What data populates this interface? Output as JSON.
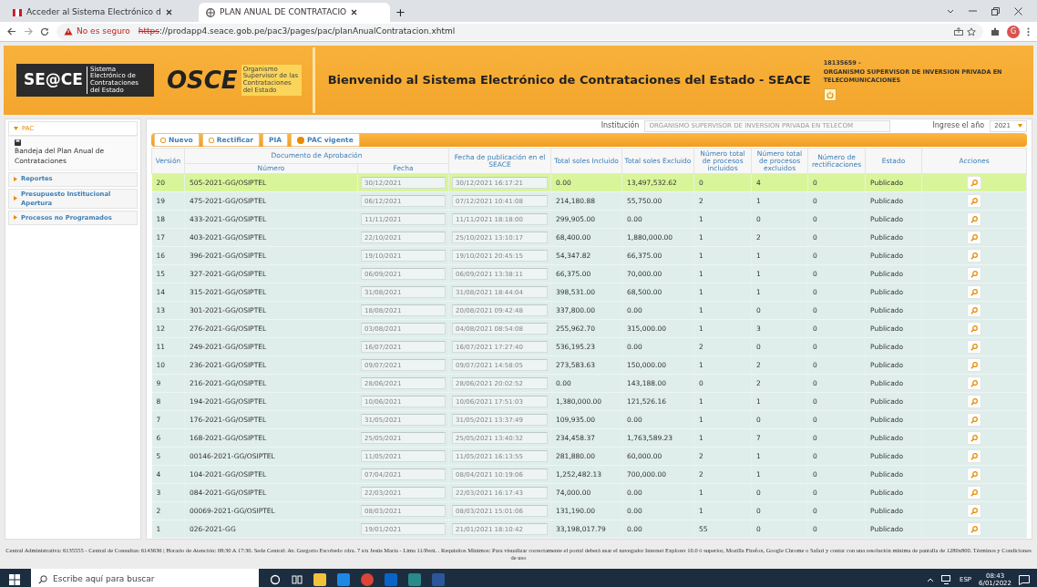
{
  "browser": {
    "tabs": [
      {
        "title": "Acceder al Sistema Electrónico d",
        "selected": false
      },
      {
        "title": "PLAN ANUAL DE CONTRATACIO",
        "selected": true
      }
    ],
    "new_tab": "+",
    "security": "No es seguro",
    "url_scheme": "https",
    "url_rest": "://prodapp4.seace.gob.pe/pac3/pages/pac/planAnualContratacion.xhtml",
    "profile": "G"
  },
  "header": {
    "seace_logo": "SE@CE",
    "seace_sub": "Sistema Electrónico de Contrataciones del Estado",
    "osce_logo": "OSCE",
    "osce_sub": "Organismo Supervisor de las Contrataciones del Estado",
    "title": "Bienvenido al Sistema Electrónico de Contrataciones del Estado - SEACE",
    "user_id": "18135659 -",
    "user_org": "ORGANISMO SUPERVISOR DE INVERSION PRIVADA EN TELECOMUNICACIONES"
  },
  "sidebar": {
    "items": [
      {
        "label": "PAC",
        "expanded": true,
        "children": [
          {
            "label": "Bandeja del Plan Anual de Contrataciones"
          }
        ]
      },
      {
        "label": "Reportes",
        "expanded": false
      },
      {
        "label": "Presupuesto Institucional Apertura",
        "expanded": false
      },
      {
        "label": "Procesos no Programados",
        "expanded": false
      }
    ]
  },
  "filters": {
    "institution_label": "Institución",
    "institution_value": "ORGANISMO SUPERVISOR DE INVERSION PRIVADA EN TELECOM",
    "year_label": "Ingrese el año",
    "year_value": "2021"
  },
  "toolbar": [
    {
      "label": "Nuevo",
      "kind": "dot"
    },
    {
      "label": "Rectificar",
      "kind": "dot"
    },
    {
      "label": "PIA",
      "kind": "plain"
    },
    {
      "label": "PAC vigente",
      "kind": "circle"
    }
  ],
  "table": {
    "group_label": "Documento de Aprobación",
    "columns": [
      "Versión",
      "Número",
      "Fecha",
      "Fecha de publicación en el SEACE",
      "Total soles Incluido",
      "Total soles Excluido",
      "Número total de procesos incluidos",
      "Número total de procesos excluidos",
      "Número de rectificaciones",
      "Estado",
      "Acciones"
    ],
    "rows": [
      {
        "selected": true,
        "cells": [
          "20",
          "505-2021-GG/OSIPTEL",
          "30/12/2021",
          "30/12/2021 16:17:21",
          "0.00",
          "13,497,532.62",
          "0",
          "4",
          "0",
          "Publicado"
        ]
      },
      {
        "selected": false,
        "cells": [
          "19",
          "475-2021-GG/OSIPTEL",
          "06/12/2021",
          "07/12/2021 10:41:08",
          "214,180.88",
          "55,750.00",
          "2",
          "1",
          "0",
          "Publicado"
        ]
      },
      {
        "selected": false,
        "cells": [
          "18",
          "433-2021-GG/OSIPTEL",
          "11/11/2021",
          "11/11/2021 18:18:00",
          "299,905.00",
          "0.00",
          "1",
          "0",
          "0",
          "Publicado"
        ]
      },
      {
        "selected": false,
        "cells": [
          "17",
          "403-2021-GG/OSIPTEL",
          "22/10/2021",
          "25/10/2021 13:10:17",
          "68,400.00",
          "1,880,000.00",
          "1",
          "2",
          "0",
          "Publicado"
        ]
      },
      {
        "selected": false,
        "cells": [
          "16",
          "396-2021-GG/OSIPTEL",
          "19/10/2021",
          "19/10/2021 20:45:15",
          "54,347.82",
          "66,375.00",
          "1",
          "1",
          "0",
          "Publicado"
        ]
      },
      {
        "selected": false,
        "cells": [
          "15",
          "327-2021-GG/OSIPTEL",
          "06/09/2021",
          "06/09/2021 13:38:11",
          "66,375.00",
          "70,000.00",
          "1",
          "1",
          "0",
          "Publicado"
        ]
      },
      {
        "selected": false,
        "cells": [
          "14",
          "315-2021-GG/OSIPTEL",
          "31/08/2021",
          "31/08/2021 18:44:04",
          "398,531.00",
          "68,500.00",
          "1",
          "1",
          "0",
          "Publicado"
        ]
      },
      {
        "selected": false,
        "cells": [
          "13",
          "301-2021-GG/OSIPTEL",
          "18/08/2021",
          "20/08/2021 09:42:48",
          "337,800.00",
          "0.00",
          "1",
          "0",
          "0",
          "Publicado"
        ]
      },
      {
        "selected": false,
        "cells": [
          "12",
          "276-2021-GG/OSIPTEL",
          "03/08/2021",
          "04/08/2021 08:54:08",
          "255,962.70",
          "315,000.00",
          "1",
          "3",
          "0",
          "Publicado"
        ]
      },
      {
        "selected": false,
        "cells": [
          "11",
          "249-2021-GG/OSIPTEL",
          "16/07/2021",
          "16/07/2021 17:27:40",
          "536,195.23",
          "0.00",
          "2",
          "0",
          "0",
          "Publicado"
        ]
      },
      {
        "selected": false,
        "cells": [
          "10",
          "236-2021-GG/OSIPTEL",
          "09/07/2021",
          "09/07/2021 14:58:05",
          "273,583.63",
          "150,000.00",
          "1",
          "2",
          "0",
          "Publicado"
        ]
      },
      {
        "selected": false,
        "cells": [
          "9",
          "216-2021-GG/OSIPTEL",
          "28/06/2021",
          "28/06/2021 20:02:52",
          "0.00",
          "143,188.00",
          "0",
          "2",
          "0",
          "Publicado"
        ]
      },
      {
        "selected": false,
        "cells": [
          "8",
          "194-2021-GG/OSIPTEL",
          "10/06/2021",
          "10/06/2021 17:51:03",
          "1,380,000.00",
          "121,526.16",
          "1",
          "1",
          "0",
          "Publicado"
        ]
      },
      {
        "selected": false,
        "cells": [
          "7",
          "176-2021-GG/OSIPTEL",
          "31/05/2021",
          "31/05/2021 13:37:49",
          "109,935.00",
          "0.00",
          "1",
          "0",
          "0",
          "Publicado"
        ]
      },
      {
        "selected": false,
        "cells": [
          "6",
          "168-2021-GG/OSIPTEL",
          "25/05/2021",
          "25/05/2021 13:40:32",
          "234,458.37",
          "1,763,589.23",
          "1",
          "7",
          "0",
          "Publicado"
        ]
      },
      {
        "selected": false,
        "cells": [
          "5",
          "00146-2021-GG/OSIPTEL",
          "11/05/2021",
          "11/05/2021 16:13:55",
          "281,880.00",
          "60,000.00",
          "2",
          "1",
          "0",
          "Publicado"
        ]
      },
      {
        "selected": false,
        "cells": [
          "4",
          "104-2021-GG/OSIPTEL",
          "07/04/2021",
          "08/04/2021 10:19:06",
          "1,252,482.13",
          "700,000.00",
          "2",
          "1",
          "0",
          "Publicado"
        ]
      },
      {
        "selected": false,
        "cells": [
          "3",
          "084-2021-GG/OSIPTEL",
          "22/03/2021",
          "22/03/2021 16:17:43",
          "74,000.00",
          "0.00",
          "1",
          "0",
          "0",
          "Publicado"
        ]
      },
      {
        "selected": false,
        "cells": [
          "2",
          "00069-2021-GG/OSIPTEL",
          "08/03/2021",
          "08/03/2021 15:01:06",
          "131,190.00",
          "0.00",
          "1",
          "0",
          "0",
          "Publicado"
        ]
      },
      {
        "selected": false,
        "cells": [
          "1",
          "026-2021-GG",
          "19/01/2021",
          "21/01/2021 18:10:42",
          "33,198,017.79",
          "0.00",
          "55",
          "0",
          "0",
          "Publicado"
        ]
      }
    ]
  },
  "footer": "Central Administrativa: 6135555 - Central de Consultas: 6143636 | Horario de Atención: 08:30 A 17:30. Sede Central: Av. Gregorio Escobedo cdra. 7 s/n Jesús María - Lima 11/Perú. . Requisitos Mínimos: Para visualizar correctamente el portal deberá usar el navegador Internet Explorer 10.0 ó superior, Mozilla Firefox, Google Chrome o Safari y contar con una resolución mínima de pantalla de 1280x800. Términos y Condiciones de uso",
  "taskbar": {
    "search_placeholder": "Escribe aquí para buscar",
    "language": "ESP",
    "time": "08:43",
    "date": "6/01/2022"
  }
}
